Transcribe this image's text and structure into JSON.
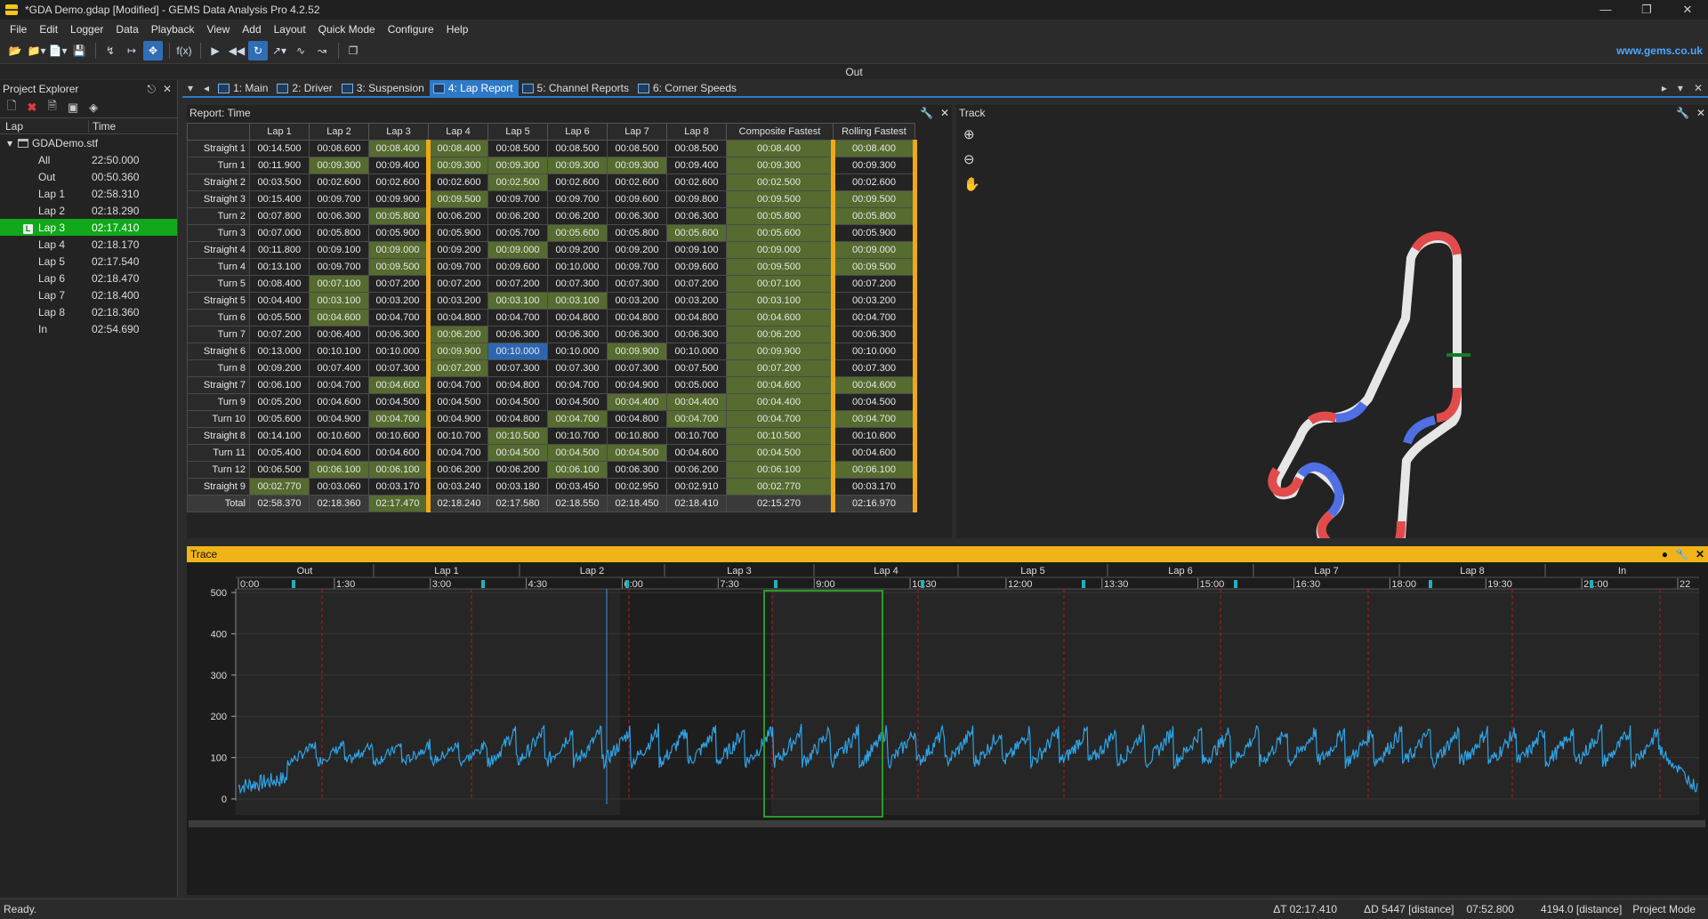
{
  "window": {
    "title": "*GDA Demo.gdap [Modified] - GEMS Data Analysis Pro 4.2.52",
    "controls": [
      "—",
      "❐",
      "✕"
    ]
  },
  "menu": [
    "File",
    "Edit",
    "Logger",
    "Data",
    "Playback",
    "View",
    "Add",
    "Layout",
    "Quick Mode",
    "Configure",
    "Help"
  ],
  "website": "www.gems.co.uk",
  "out_label": "Out",
  "toolbar_fx": "f(x)",
  "project_explorer": {
    "title": "Project Explorer",
    "col_lap": "Lap",
    "col_time": "Time",
    "root": "GDADemo.stf",
    "rows": [
      {
        "name": "All",
        "time": "22:50.000"
      },
      {
        "name": "Out",
        "time": "00:50.360"
      },
      {
        "name": "Lap 1",
        "time": "02:58.310"
      },
      {
        "name": "Lap 2",
        "time": "02:18.290"
      },
      {
        "name": "Lap 3",
        "time": "02:17.410"
      },
      {
        "name": "Lap 4",
        "time": "02:18.170"
      },
      {
        "name": "Lap 5",
        "time": "02:17.540"
      },
      {
        "name": "Lap 6",
        "time": "02:18.470"
      },
      {
        "name": "Lap 7",
        "time": "02:18.400"
      },
      {
        "name": "Lap 8",
        "time": "02:18.360"
      },
      {
        "name": "In",
        "time": "02:54.690"
      }
    ],
    "selected_badge": "L"
  },
  "tabs": [
    "1: Main",
    "2: Driver",
    "3: Suspension",
    "4: Lap Report",
    "5: Channel Reports",
    "6: Corner Speeds"
  ],
  "report": {
    "title": "Report: Time",
    "columns": [
      "Lap 1",
      "Lap 2",
      "Lap 3",
      "Lap 4",
      "Lap 5",
      "Lap 6",
      "Lap 7",
      "Lap 8",
      "Composite Fastest",
      "Rolling Fastest"
    ],
    "rows": [
      {
        "label": "Straight 1",
        "v": [
          "00:14.500",
          "00:08.600",
          "00:08.400",
          "00:08.400",
          "00:08.500",
          "00:08.500",
          "00:08.500",
          "00:08.500",
          "00:08.400",
          "00:08.400"
        ],
        "g": [
          2,
          3,
          8,
          9
        ]
      },
      {
        "label": "Turn 1",
        "v": [
          "00:11.900",
          "00:09.300",
          "00:09.400",
          "00:09.300",
          "00:09.300",
          "00:09.300",
          "00:09.300",
          "00:09.400",
          "00:09.300",
          "00:09.300"
        ],
        "g": [
          1,
          3,
          4,
          5,
          6,
          8
        ]
      },
      {
        "label": "Straight 2",
        "v": [
          "00:03.500",
          "00:02.600",
          "00:02.600",
          "00:02.600",
          "00:02.500",
          "00:02.600",
          "00:02.600",
          "00:02.600",
          "00:02.500",
          "00:02.600"
        ],
        "g": [
          4,
          8
        ]
      },
      {
        "label": "Straight 3",
        "v": [
          "00:15.400",
          "00:09.700",
          "00:09.900",
          "00:09.500",
          "00:09.700",
          "00:09.700",
          "00:09.600",
          "00:09.800",
          "00:09.500",
          "00:09.500"
        ],
        "g": [
          3,
          8,
          9
        ]
      },
      {
        "label": "Turn 2",
        "v": [
          "00:07.800",
          "00:06.300",
          "00:05.800",
          "00:06.200",
          "00:06.200",
          "00:06.200",
          "00:06.300",
          "00:06.300",
          "00:05.800",
          "00:05.800"
        ],
        "g": [
          2,
          8,
          9
        ]
      },
      {
        "label": "Turn 3",
        "v": [
          "00:07.000",
          "00:05.800",
          "00:05.900",
          "00:05.900",
          "00:05.700",
          "00:05.600",
          "00:05.800",
          "00:05.600",
          "00:05.600",
          "00:05.900"
        ],
        "g": [
          5,
          7,
          8
        ]
      },
      {
        "label": "Straight 4",
        "v": [
          "00:11.800",
          "00:09.100",
          "00:09.000",
          "00:09.200",
          "00:09.000",
          "00:09.200",
          "00:09.200",
          "00:09.100",
          "00:09.000",
          "00:09.000"
        ],
        "g": [
          2,
          4,
          8,
          9
        ]
      },
      {
        "label": "Turn 4",
        "v": [
          "00:13.100",
          "00:09.700",
          "00:09.500",
          "00:09.700",
          "00:09.600",
          "00:10.000",
          "00:09.700",
          "00:09.600",
          "00:09.500",
          "00:09.500"
        ],
        "g": [
          2,
          8,
          9
        ]
      },
      {
        "label": "Turn 5",
        "v": [
          "00:08.400",
          "00:07.100",
          "00:07.200",
          "00:07.200",
          "00:07.200",
          "00:07.300",
          "00:07.300",
          "00:07.200",
          "00:07.100",
          "00:07.200"
        ],
        "g": [
          1,
          8
        ]
      },
      {
        "label": "Straight 5",
        "v": [
          "00:04.400",
          "00:03.100",
          "00:03.200",
          "00:03.200",
          "00:03.100",
          "00:03.100",
          "00:03.200",
          "00:03.200",
          "00:03.100",
          "00:03.200"
        ],
        "g": [
          1,
          4,
          5,
          8
        ]
      },
      {
        "label": "Turn 6",
        "v": [
          "00:05.500",
          "00:04.600",
          "00:04.700",
          "00:04.800",
          "00:04.700",
          "00:04.800",
          "00:04.800",
          "00:04.800",
          "00:04.600",
          "00:04.700"
        ],
        "g": [
          1,
          8
        ]
      },
      {
        "label": "Turn 7",
        "v": [
          "00:07.200",
          "00:06.400",
          "00:06.300",
          "00:06.200",
          "00:06.300",
          "00:06.300",
          "00:06.300",
          "00:06.300",
          "00:06.200",
          "00:06.300"
        ],
        "g": [
          3,
          8
        ]
      },
      {
        "label": "Straight 6",
        "v": [
          "00:13.000",
          "00:10.100",
          "00:10.000",
          "00:09.900",
          "00:10.000",
          "00:10.000",
          "00:09.900",
          "00:10.000",
          "00:09.900",
          "00:10.000"
        ],
        "g": [
          3,
          6,
          8
        ],
        "b": [
          4
        ]
      },
      {
        "label": "Turn 8",
        "v": [
          "00:09.200",
          "00:07.400",
          "00:07.300",
          "00:07.200",
          "00:07.300",
          "00:07.300",
          "00:07.300",
          "00:07.500",
          "00:07.200",
          "00:07.300"
        ],
        "g": [
          3,
          8
        ]
      },
      {
        "label": "Straight 7",
        "v": [
          "00:06.100",
          "00:04.700",
          "00:04.600",
          "00:04.700",
          "00:04.800",
          "00:04.700",
          "00:04.900",
          "00:05.000",
          "00:04.600",
          "00:04.600"
        ],
        "g": [
          2,
          8,
          9
        ]
      },
      {
        "label": "Turn 9",
        "v": [
          "00:05.200",
          "00:04.600",
          "00:04.500",
          "00:04.500",
          "00:04.500",
          "00:04.500",
          "00:04.400",
          "00:04.400",
          "00:04.400",
          "00:04.500"
        ],
        "g": [
          6,
          7,
          8
        ]
      },
      {
        "label": "Turn 10",
        "v": [
          "00:05.600",
          "00:04.900",
          "00:04.700",
          "00:04.900",
          "00:04.800",
          "00:04.700",
          "00:04.800",
          "00:04.700",
          "00:04.700",
          "00:04.700"
        ],
        "g": [
          2,
          5,
          7,
          8,
          9
        ]
      },
      {
        "label": "Straight 8",
        "v": [
          "00:14.100",
          "00:10.600",
          "00:10.600",
          "00:10.700",
          "00:10.500",
          "00:10.700",
          "00:10.800",
          "00:10.700",
          "00:10.500",
          "00:10.600"
        ],
        "g": [
          4,
          8
        ]
      },
      {
        "label": "Turn 11",
        "v": [
          "00:05.400",
          "00:04.600",
          "00:04.600",
          "00:04.700",
          "00:04.500",
          "00:04.500",
          "00:04.500",
          "00:04.600",
          "00:04.500",
          "00:04.600"
        ],
        "g": [
          4,
          5,
          6,
          8
        ]
      },
      {
        "label": "Turn 12",
        "v": [
          "00:06.500",
          "00:06.100",
          "00:06.100",
          "00:06.200",
          "00:06.200",
          "00:06.100",
          "00:06.300",
          "00:06.200",
          "00:06.100",
          "00:06.100"
        ],
        "g": [
          1,
          2,
          5,
          8,
          9
        ]
      },
      {
        "label": "Straight 9",
        "v": [
          "00:02.770",
          "00:03.060",
          "00:03.170",
          "00:03.240",
          "00:03.180",
          "00:03.450",
          "00:02.950",
          "00:02.910",
          "00:02.770",
          "00:03.170"
        ],
        "g": [
          0,
          8
        ]
      }
    ],
    "total": {
      "label": "Total",
      "v": [
        "02:58.370",
        "02:18.360",
        "02:17.470",
        "02:18.240",
        "02:17.580",
        "02:18.550",
        "02:18.450",
        "02:18.410",
        "02:15.270",
        "02:16.970"
      ],
      "g": [
        2
      ]
    }
  },
  "track": {
    "title": "Track"
  },
  "trace": {
    "title": "Trace",
    "laps": [
      "Out",
      "Lap 1",
      "Lap 2",
      "Lap 3",
      "Lap 4",
      "Lap 5",
      "Lap 6",
      "Lap 7",
      "Lap 8",
      "In"
    ],
    "time_ticks": [
      "0:00",
      "1:30",
      "3:00",
      "4:30",
      "6:00",
      "7:30",
      "9:00",
      "10:30",
      "12:00",
      "13:30",
      "15:00",
      "16:30",
      "18:00",
      "19:30",
      "21:00",
      "22"
    ],
    "y_ticks": [
      "500",
      "400",
      "300",
      "200",
      "100",
      "0"
    ]
  },
  "status": {
    "ready": "Ready.",
    "delta_t": "ΔT 02:17.410",
    "delta_d": "ΔD 5447 [distance]",
    "time": "07:52.800",
    "distance": "4194.0 [distance]",
    "mode": "Project Mode"
  }
}
